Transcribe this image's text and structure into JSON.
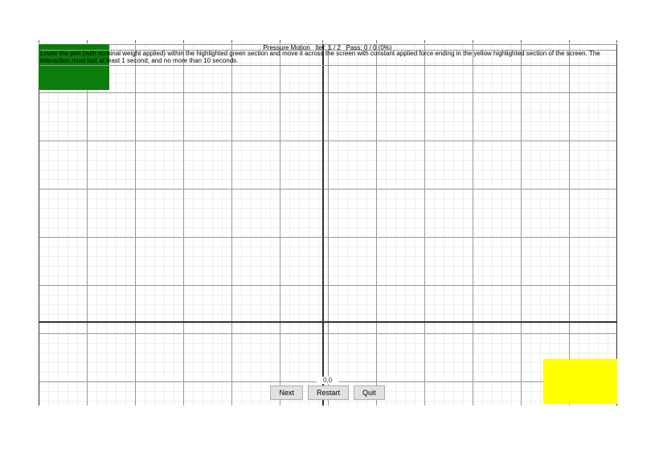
{
  "header": {
    "title_prefix": "Pressure Motion",
    "iter_label": "Iter:",
    "iter_value": "1 / 2",
    "pass_label": "Pass:",
    "pass_value": "0 / 0 (0%)"
  },
  "instruction_text": "Lower the pen (with nominal weight applied) within the highlighted green section and move it across the screen with constant applied force ending in the yellow highlighted section of the screen. The interaction must last at least 1 second, and no more than 10 seconds.",
  "zero_label": "0,0",
  "buttons": {
    "next": "Next",
    "restart": "Restart",
    "quit": "Quit"
  },
  "zones": {
    "start": {
      "color": "#0a7d0a",
      "name": "green-start-zone"
    },
    "end": {
      "color": "#ffff00",
      "name": "yellow-end-zone"
    }
  }
}
